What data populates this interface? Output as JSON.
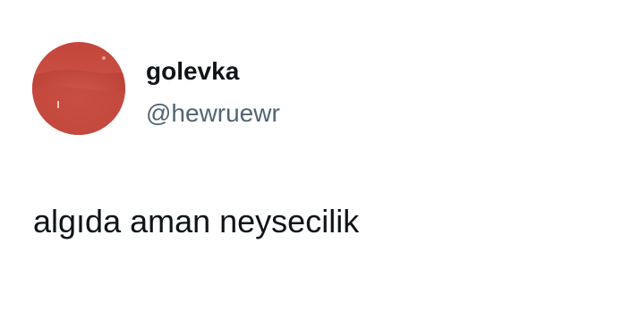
{
  "tweet": {
    "author": {
      "display_name": "golevka",
      "handle": "@hewruewr",
      "avatar_icon": "avatar-red-landscape"
    },
    "text": "algıda aman neysecilik"
  },
  "colors": {
    "name": "#0f1419",
    "handle": "#536471",
    "text": "#0f1419",
    "avatar_primary": "#c9493f"
  }
}
